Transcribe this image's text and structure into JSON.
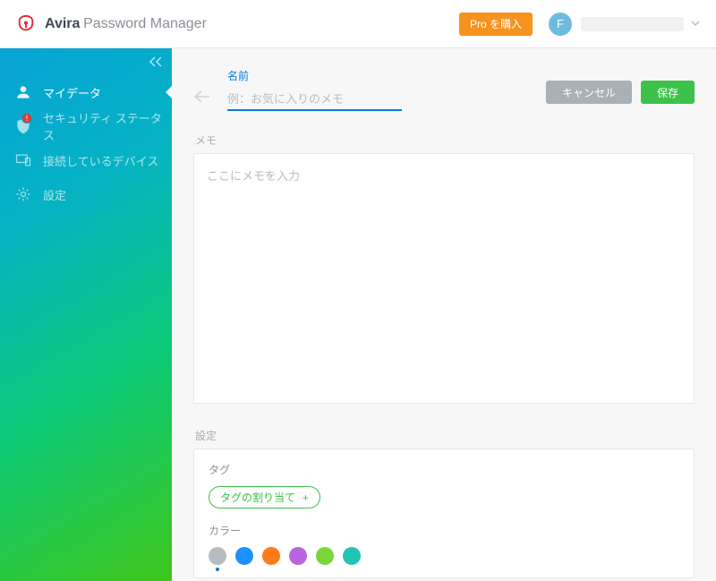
{
  "header": {
    "brand_name": "Avira",
    "brand_sub": "Password Manager",
    "buy_pro_label": "Pro を購入",
    "avatar_initial": "F"
  },
  "sidebar": {
    "items": [
      {
        "label": "マイデータ"
      },
      {
        "label": "セキュリティ ステータス"
      },
      {
        "label": "接続しているデバイス"
      },
      {
        "label": "設定"
      }
    ]
  },
  "form": {
    "name_label": "名前",
    "name_placeholder": "例：お気に入りのメモ",
    "name_value": "",
    "cancel_label": "キャンセル",
    "save_label": "保存",
    "memo_section_label": "メモ",
    "memo_placeholder": "ここにメモを入力",
    "memo_value": "",
    "settings_section_label": "設定",
    "tag_label": "タグ",
    "tag_assign_label": "タグの割り当て",
    "color_label": "カラー"
  },
  "colors": {
    "swatches": [
      "#b7bcc2",
      "#1e90ff",
      "#ff7b1a",
      "#b866e0",
      "#7bd63a",
      "#24c3b5"
    ],
    "selected_index": 0
  }
}
